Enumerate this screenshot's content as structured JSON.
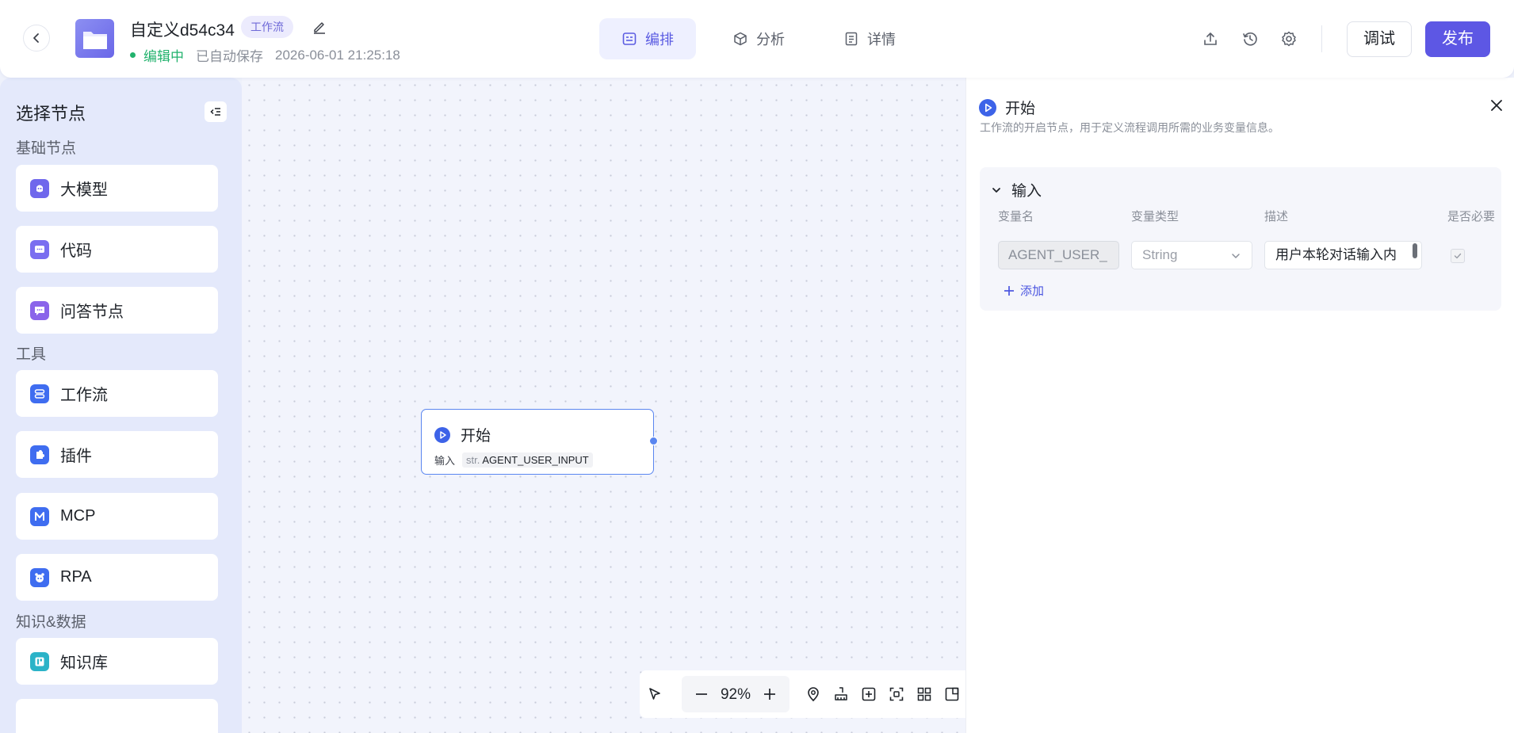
{
  "header": {
    "title": "自定义d54c34",
    "type_badge": "工作流",
    "status": "编辑中",
    "autosave": "已自动保存",
    "save_time": "2026-06-01 21:25:18",
    "tabs": [
      {
        "label": "编排",
        "icon": "layout-icon",
        "active": true
      },
      {
        "label": "分析",
        "icon": "cube-icon",
        "active": false
      },
      {
        "label": "详情",
        "icon": "document-icon",
        "active": false
      }
    ],
    "debug_label": "调试",
    "publish_label": "发布",
    "accent_color": "#5d57e4"
  },
  "sidebar": {
    "title": "选择节点",
    "sections": [
      {
        "label": "基础节点",
        "items": [
          {
            "label": "大模型",
            "icon": "llm-icon"
          },
          {
            "label": "代码",
            "icon": "code-icon"
          },
          {
            "label": "问答节点",
            "icon": "qa-icon"
          }
        ]
      },
      {
        "label": "工具",
        "items": [
          {
            "label": "工作流",
            "icon": "workflow-icon"
          },
          {
            "label": "插件",
            "icon": "plugin-icon"
          },
          {
            "label": "MCP",
            "icon": "mcp-icon"
          },
          {
            "label": "RPA",
            "icon": "rpa-icon"
          }
        ]
      },
      {
        "label": "知识&数据",
        "items": [
          {
            "label": "知识库",
            "icon": "knowledge-icon"
          }
        ]
      }
    ]
  },
  "canvas": {
    "start_node": {
      "title": "开始",
      "io_label": "输入",
      "var_type": "str.",
      "var_name": "AGENT_USER_INPUT"
    },
    "zoom": "92%"
  },
  "panel": {
    "title": "开始",
    "description": "工作流的开启节点，用于定义流程调用所需的业务变量信息。",
    "input_section": {
      "title": "输入",
      "columns": [
        "变量名",
        "变量类型",
        "描述",
        "是否必要"
      ],
      "row": {
        "name": "AGENT_USER_",
        "type": "String",
        "description": "用户本轮对话输入内",
        "required": true
      },
      "add_label": "添加"
    }
  }
}
